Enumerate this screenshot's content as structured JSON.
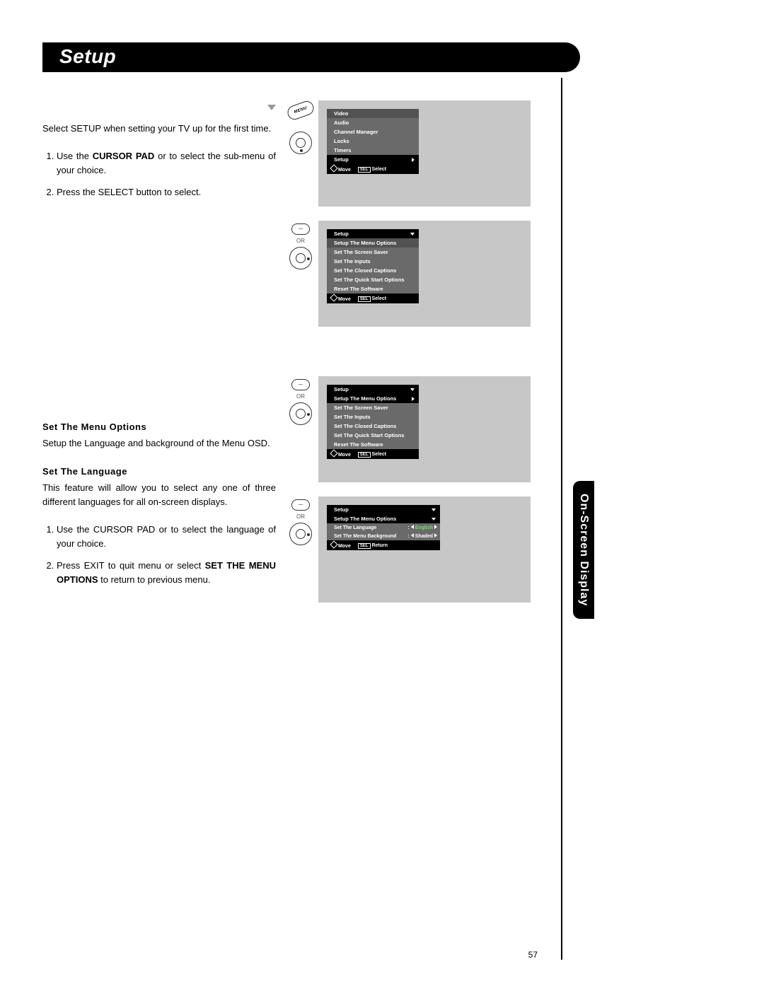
{
  "header": {
    "title": "Setup"
  },
  "intro": "Select SETUP when setting your TV up for the first time.",
  "steps_a": {
    "s1_pre": "Use the ",
    "s1_bold": "CURSOR PAD",
    "s1_mid": "     or      to select the sub-menu of your choice.",
    "s2": "Press the SELECT button to select."
  },
  "section_b": {
    "heading": "Set The Menu Options",
    "text": "Setup the Language and background of the Menu OSD."
  },
  "section_c": {
    "heading": "Set The Language",
    "text": "This feature will allow you to select any one of three different languages for all on-screen displays.",
    "s1": "Use the CURSOR PAD     or     to select the language of your choice.",
    "s2_pre": "Press EXIT to quit menu or select ",
    "s2_bold": "SET THE MENU OPTIONS",
    "s2_post": " to return to previous menu."
  },
  "remote": {
    "menu": "MENU",
    "or": "OR"
  },
  "osd1": {
    "items": [
      "Video",
      "Audio",
      "Channel Manager",
      "Locks",
      "Timers"
    ],
    "selected": "Setup",
    "foot_move": "Move",
    "foot_sel": "SEL",
    "foot_select": "Select"
  },
  "osd2": {
    "header": "Setup",
    "items": [
      "Setup The Menu Options",
      "Set The Screen Saver",
      "Set The Inputs",
      "Set The Closed Captions",
      "Set The Quick Start Options",
      "Reset The Software"
    ],
    "foot_move": "Move",
    "foot_sel": "SEL",
    "foot_select": "Select"
  },
  "osd3": {
    "header": "Setup",
    "selected": "Setup The Menu Options",
    "items": [
      "Set The Screen Saver",
      "Set The Inputs",
      "Set The Closed Captions",
      "Set The Quick Start Options",
      "Reset The Software"
    ],
    "foot_move": "Move",
    "foot_sel": "SEL",
    "foot_select": "Select"
  },
  "osd4": {
    "header": "Setup",
    "sub": "Setup The Menu Options",
    "opt1_label": "Set The Language",
    "opt1_val": "English",
    "opt2_label": "Set The Menu Background",
    "opt2_val": "Shaded",
    "foot_move": "Move",
    "foot_sel": "SEL",
    "foot_return": "Return"
  },
  "side_tab": "On-Screen Display",
  "page_number": "57"
}
